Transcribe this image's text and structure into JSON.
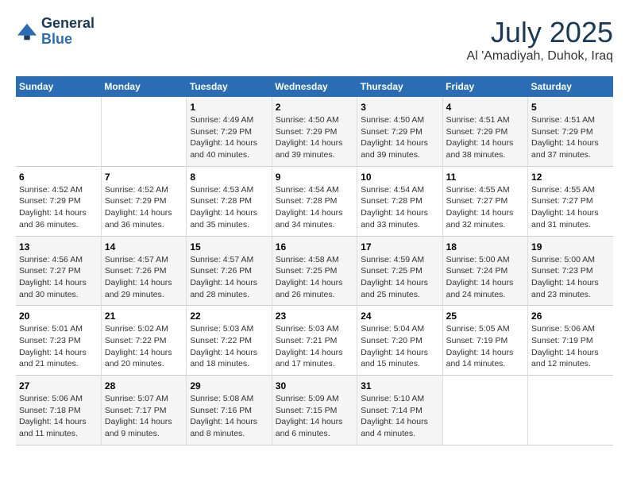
{
  "logo": {
    "line1": "General",
    "line2": "Blue"
  },
  "title": "July 2025",
  "subtitle": "Al 'Amadiyah, Duhok, Iraq",
  "days_of_week": [
    "Sunday",
    "Monday",
    "Tuesday",
    "Wednesday",
    "Thursday",
    "Friday",
    "Saturday"
  ],
  "weeks": [
    [
      {
        "day": null
      },
      {
        "day": null
      },
      {
        "day": "1",
        "sunrise": "Sunrise: 4:49 AM",
        "sunset": "Sunset: 7:29 PM",
        "daylight": "Daylight: 14 hours and 40 minutes."
      },
      {
        "day": "2",
        "sunrise": "Sunrise: 4:50 AM",
        "sunset": "Sunset: 7:29 PM",
        "daylight": "Daylight: 14 hours and 39 minutes."
      },
      {
        "day": "3",
        "sunrise": "Sunrise: 4:50 AM",
        "sunset": "Sunset: 7:29 PM",
        "daylight": "Daylight: 14 hours and 39 minutes."
      },
      {
        "day": "4",
        "sunrise": "Sunrise: 4:51 AM",
        "sunset": "Sunset: 7:29 PM",
        "daylight": "Daylight: 14 hours and 38 minutes."
      },
      {
        "day": "5",
        "sunrise": "Sunrise: 4:51 AM",
        "sunset": "Sunset: 7:29 PM",
        "daylight": "Daylight: 14 hours and 37 minutes."
      }
    ],
    [
      {
        "day": "6",
        "sunrise": "Sunrise: 4:52 AM",
        "sunset": "Sunset: 7:29 PM",
        "daylight": "Daylight: 14 hours and 36 minutes."
      },
      {
        "day": "7",
        "sunrise": "Sunrise: 4:52 AM",
        "sunset": "Sunset: 7:29 PM",
        "daylight": "Daylight: 14 hours and 36 minutes."
      },
      {
        "day": "8",
        "sunrise": "Sunrise: 4:53 AM",
        "sunset": "Sunset: 7:28 PM",
        "daylight": "Daylight: 14 hours and 35 minutes."
      },
      {
        "day": "9",
        "sunrise": "Sunrise: 4:54 AM",
        "sunset": "Sunset: 7:28 PM",
        "daylight": "Daylight: 14 hours and 34 minutes."
      },
      {
        "day": "10",
        "sunrise": "Sunrise: 4:54 AM",
        "sunset": "Sunset: 7:28 PM",
        "daylight": "Daylight: 14 hours and 33 minutes."
      },
      {
        "day": "11",
        "sunrise": "Sunrise: 4:55 AM",
        "sunset": "Sunset: 7:27 PM",
        "daylight": "Daylight: 14 hours and 32 minutes."
      },
      {
        "day": "12",
        "sunrise": "Sunrise: 4:55 AM",
        "sunset": "Sunset: 7:27 PM",
        "daylight": "Daylight: 14 hours and 31 minutes."
      }
    ],
    [
      {
        "day": "13",
        "sunrise": "Sunrise: 4:56 AM",
        "sunset": "Sunset: 7:27 PM",
        "daylight": "Daylight: 14 hours and 30 minutes."
      },
      {
        "day": "14",
        "sunrise": "Sunrise: 4:57 AM",
        "sunset": "Sunset: 7:26 PM",
        "daylight": "Daylight: 14 hours and 29 minutes."
      },
      {
        "day": "15",
        "sunrise": "Sunrise: 4:57 AM",
        "sunset": "Sunset: 7:26 PM",
        "daylight": "Daylight: 14 hours and 28 minutes."
      },
      {
        "day": "16",
        "sunrise": "Sunrise: 4:58 AM",
        "sunset": "Sunset: 7:25 PM",
        "daylight": "Daylight: 14 hours and 26 minutes."
      },
      {
        "day": "17",
        "sunrise": "Sunrise: 4:59 AM",
        "sunset": "Sunset: 7:25 PM",
        "daylight": "Daylight: 14 hours and 25 minutes."
      },
      {
        "day": "18",
        "sunrise": "Sunrise: 5:00 AM",
        "sunset": "Sunset: 7:24 PM",
        "daylight": "Daylight: 14 hours and 24 minutes."
      },
      {
        "day": "19",
        "sunrise": "Sunrise: 5:00 AM",
        "sunset": "Sunset: 7:23 PM",
        "daylight": "Daylight: 14 hours and 23 minutes."
      }
    ],
    [
      {
        "day": "20",
        "sunrise": "Sunrise: 5:01 AM",
        "sunset": "Sunset: 7:23 PM",
        "daylight": "Daylight: 14 hours and 21 minutes."
      },
      {
        "day": "21",
        "sunrise": "Sunrise: 5:02 AM",
        "sunset": "Sunset: 7:22 PM",
        "daylight": "Daylight: 14 hours and 20 minutes."
      },
      {
        "day": "22",
        "sunrise": "Sunrise: 5:03 AM",
        "sunset": "Sunset: 7:22 PM",
        "daylight": "Daylight: 14 hours and 18 minutes."
      },
      {
        "day": "23",
        "sunrise": "Sunrise: 5:03 AM",
        "sunset": "Sunset: 7:21 PM",
        "daylight": "Daylight: 14 hours and 17 minutes."
      },
      {
        "day": "24",
        "sunrise": "Sunrise: 5:04 AM",
        "sunset": "Sunset: 7:20 PM",
        "daylight": "Daylight: 14 hours and 15 minutes."
      },
      {
        "day": "25",
        "sunrise": "Sunrise: 5:05 AM",
        "sunset": "Sunset: 7:19 PM",
        "daylight": "Daylight: 14 hours and 14 minutes."
      },
      {
        "day": "26",
        "sunrise": "Sunrise: 5:06 AM",
        "sunset": "Sunset: 7:19 PM",
        "daylight": "Daylight: 14 hours and 12 minutes."
      }
    ],
    [
      {
        "day": "27",
        "sunrise": "Sunrise: 5:06 AM",
        "sunset": "Sunset: 7:18 PM",
        "daylight": "Daylight: 14 hours and 11 minutes."
      },
      {
        "day": "28",
        "sunrise": "Sunrise: 5:07 AM",
        "sunset": "Sunset: 7:17 PM",
        "daylight": "Daylight: 14 hours and 9 minutes."
      },
      {
        "day": "29",
        "sunrise": "Sunrise: 5:08 AM",
        "sunset": "Sunset: 7:16 PM",
        "daylight": "Daylight: 14 hours and 8 minutes."
      },
      {
        "day": "30",
        "sunrise": "Sunrise: 5:09 AM",
        "sunset": "Sunset: 7:15 PM",
        "daylight": "Daylight: 14 hours and 6 minutes."
      },
      {
        "day": "31",
        "sunrise": "Sunrise: 5:10 AM",
        "sunset": "Sunset: 7:14 PM",
        "daylight": "Daylight: 14 hours and 4 minutes."
      },
      {
        "day": null
      },
      {
        "day": null
      }
    ]
  ]
}
